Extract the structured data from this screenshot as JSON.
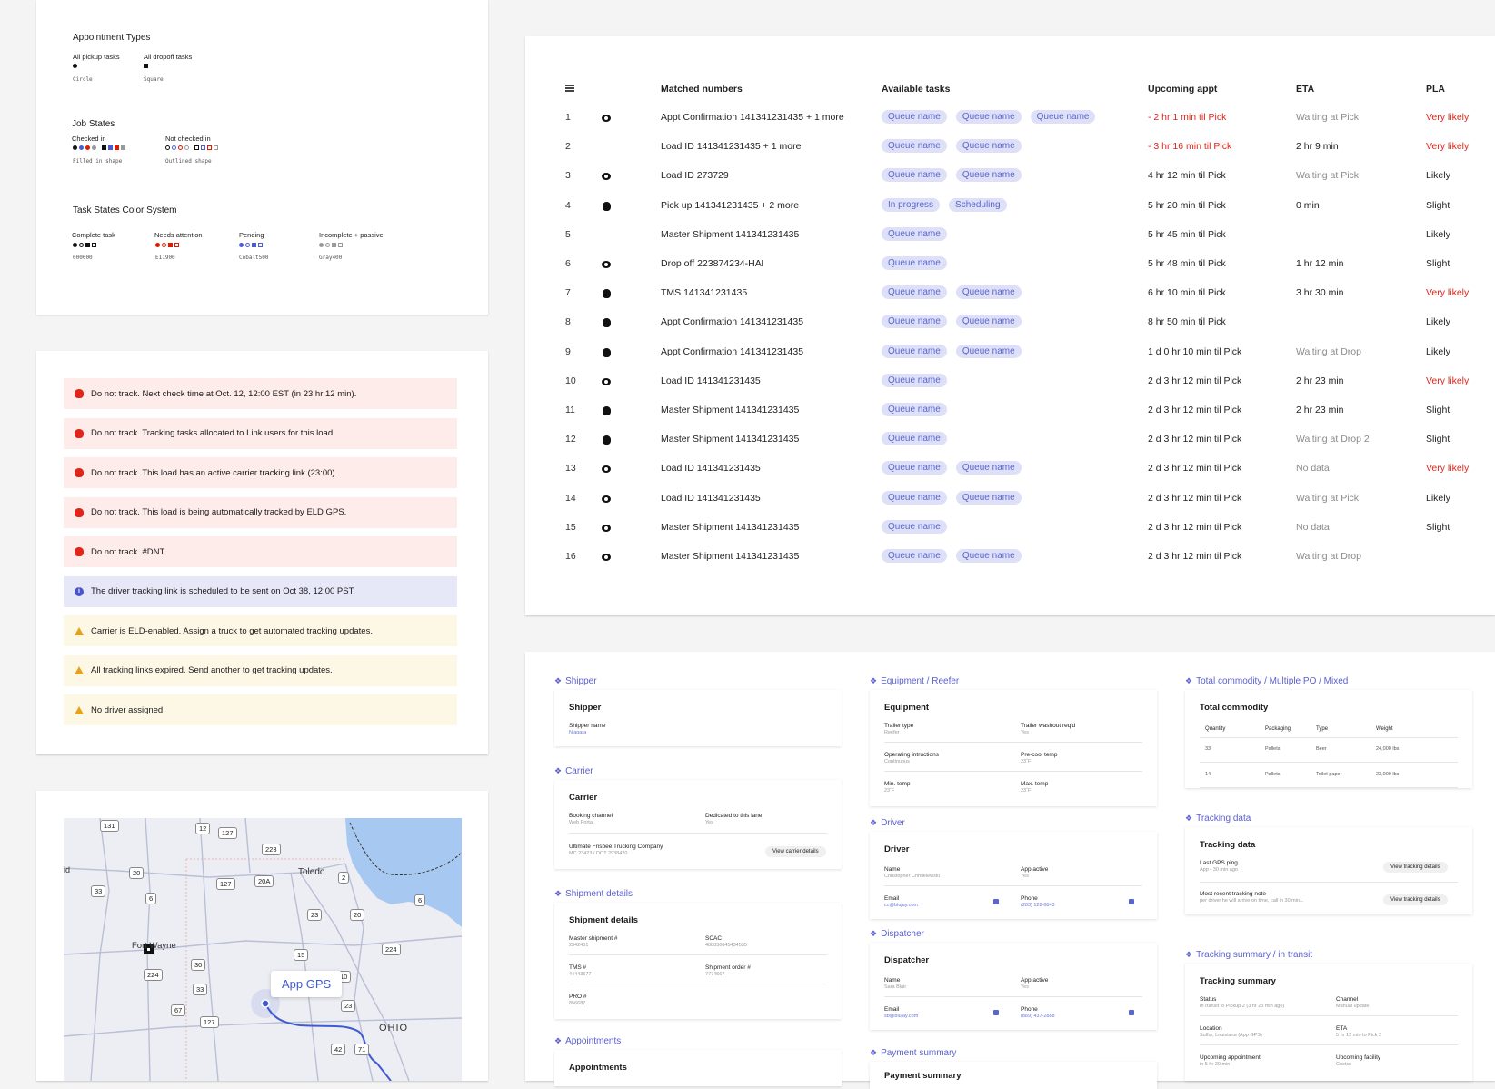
{
  "legend": {
    "appt_types": {
      "title": "Appointment Types",
      "pickup_label": "All pickup tasks",
      "pickup_shape": "Circle",
      "dropoff_label": "All dropoff tasks",
      "dropoff_shape": "Square"
    },
    "job_states": {
      "title": "Job States",
      "checked_in": "Checked in",
      "checked_in_caption": "Filled in shape",
      "not_checked_in": "Not checked in",
      "not_checked_in_caption": "Outlined shape"
    },
    "task_states": {
      "title": "Task States Color System",
      "complete": "Complete task",
      "complete_code": "000000",
      "attention": "Needs attention",
      "attention_code": "E11900",
      "pending": "Pending",
      "pending_code": "Cobalt500",
      "incomplete": "Incomplete + passive",
      "incomplete_code": "Gray400"
    },
    "colors": {
      "black": "#111111",
      "red": "#e11900",
      "blue": "#4a5cd8",
      "gray": "#9a9a9a"
    }
  },
  "banners": [
    {
      "type": "red",
      "icon": "hand-stop-icon",
      "text": "Do not track. Next check time at Oct. 12, 12:00 EST (in 23 hr 12 min)."
    },
    {
      "type": "red",
      "icon": "hand-stop-icon",
      "text": "Do not track. Tracking tasks allocated to Link users for this load."
    },
    {
      "type": "red",
      "icon": "hand-stop-icon",
      "text": "Do not track. This load has an active carrier tracking link (23:00)."
    },
    {
      "type": "red",
      "icon": "hand-stop-icon",
      "text": "Do not track. This load is being automatically tracked by ELD GPS."
    },
    {
      "type": "red",
      "icon": "hand-stop-icon",
      "text": "Do not track. #DNT"
    },
    {
      "type": "blue",
      "icon": "info-icon",
      "text": "The driver tracking link is scheduled to be sent on Oct 38, 12:00 PST."
    },
    {
      "type": "yel",
      "icon": "warning-icon",
      "text": "Carrier is ELD-enabled. Assign a truck to get automated tracking updates."
    },
    {
      "type": "yel",
      "icon": "warning-icon",
      "text": "All tracking links expired. Send another to get tracking updates."
    },
    {
      "type": "yel",
      "icon": "warning-icon",
      "text": "No driver assigned."
    }
  ],
  "map": {
    "tooltip": "App GPS",
    "places": [
      "Toledo",
      "Fort Wayne",
      "OHIO",
      "id"
    ],
    "shields": [
      "131",
      "12",
      "127",
      "223",
      "20",
      "127",
      "20A",
      "2",
      "33",
      "6",
      "6",
      "23",
      "20",
      "Fort Wayne",
      "224",
      "15",
      "224",
      "30",
      "10",
      "33",
      "67",
      "127",
      "23",
      "42",
      "71"
    ]
  },
  "table": {
    "headers": {
      "matched": "Matched numbers",
      "tasks": "Available tasks",
      "appt": "Upcoming appt",
      "eta": "ETA",
      "pla": "PLA"
    },
    "rows": [
      {
        "n": "1",
        "icon": "eye",
        "matched": "Appt Confirmation 141341231435 + 1 more",
        "chips": [
          "Queue name",
          "Queue name",
          "Queue name"
        ],
        "appt": "- 2 hr 1 min til Pick",
        "appt_red": true,
        "eta": "Waiting at Pick",
        "eta_gray": true,
        "pla": "Very likely",
        "pla_red": true
      },
      {
        "n": "2",
        "icon": "",
        "matched": "Load ID 141341231435 + 1 more",
        "chips": [
          "Queue name",
          "Queue name"
        ],
        "appt": "- 3 hr 16 min til Pick",
        "appt_red": true,
        "eta": "2 hr 9 min",
        "eta_gray": false,
        "pla": "Very likely",
        "pla_red": true
      },
      {
        "n": "3",
        "icon": "eye",
        "matched": "Load ID 273729",
        "chips": [
          "Queue name",
          "Queue name"
        ],
        "appt": "4 hr 12 min til Pick",
        "appt_red": false,
        "eta": "Waiting at Pick",
        "eta_gray": true,
        "pla": "Likely",
        "pla_red": false
      },
      {
        "n": "4",
        "icon": "hand",
        "matched": "Pick up 141341231435 + 2 more",
        "chips": [
          "In progress",
          "Scheduling"
        ],
        "appt": "5 hr 20 min til Pick",
        "appt_red": false,
        "eta": "0 min",
        "eta_gray": false,
        "pla": "Slight",
        "pla_red": false
      },
      {
        "n": "5",
        "icon": "",
        "matched": "Master Shipment 141341231435",
        "chips": [
          "Queue name"
        ],
        "appt": "5 hr 45 min til Pick",
        "appt_red": false,
        "eta": "",
        "eta_gray": false,
        "pla": "Likely",
        "pla_red": false
      },
      {
        "n": "6",
        "icon": "eye",
        "matched": "Drop off 223874234-HAI",
        "chips": [
          "Queue name"
        ],
        "appt": "5 hr 48 min til Pick",
        "appt_red": false,
        "eta": "1 hr 12 min",
        "eta_gray": false,
        "pla": "Slight",
        "pla_red": false
      },
      {
        "n": "7",
        "icon": "hand",
        "matched": "TMS 141341231435",
        "chips": [
          "Queue name",
          "Queue name"
        ],
        "appt": "6 hr 10 min til Pick",
        "appt_red": false,
        "eta": "3 hr 30 min",
        "eta_gray": false,
        "pla": "Very likely",
        "pla_red": true
      },
      {
        "n": "8",
        "icon": "hand",
        "matched": "Appt Confirmation 141341231435",
        "chips": [
          "Queue name",
          "Queue name"
        ],
        "appt": "8 hr 50 min til Pick",
        "appt_red": false,
        "eta": "",
        "eta_gray": false,
        "pla": "Likely",
        "pla_red": false
      },
      {
        "n": "9",
        "icon": "hand",
        "matched": "Appt Confirmation 141341231435",
        "chips": [
          "Queue name",
          "Queue name"
        ],
        "appt": "1 d 0 hr 10 min til Pick",
        "appt_red": false,
        "eta": "Waiting at Drop",
        "eta_gray": true,
        "pla": "Likely",
        "pla_red": false
      },
      {
        "n": "10",
        "icon": "eye",
        "matched": "Load ID 141341231435",
        "chips": [
          "Queue name"
        ],
        "appt": "2 d 3 hr 12 min til Pick",
        "appt_red": false,
        "eta": "2 hr 23 min",
        "eta_gray": false,
        "pla": "Very likely",
        "pla_red": true
      },
      {
        "n": "11",
        "icon": "hand",
        "matched": "Master Shipment 141341231435",
        "chips": [
          "Queue name"
        ],
        "appt": "2 d 3 hr 12 min til Pick",
        "appt_red": false,
        "eta": "2 hr 23 min",
        "eta_gray": false,
        "pla": "Slight",
        "pla_red": false
      },
      {
        "n": "12",
        "icon": "hand",
        "matched": "Master Shipment 141341231435",
        "chips": [
          "Queue name"
        ],
        "appt": "2 d 3 hr 12 min til Pick",
        "appt_red": false,
        "eta": "Waiting at Drop 2",
        "eta_gray": true,
        "pla": "Slight",
        "pla_red": false
      },
      {
        "n": "13",
        "icon": "eye",
        "matched": "Load ID 141341231435",
        "chips": [
          "Queue name",
          "Queue name"
        ],
        "appt": "2 d 3 hr 12 min til Pick",
        "appt_red": false,
        "eta": "No data",
        "eta_gray": true,
        "pla": "Very likely",
        "pla_red": true
      },
      {
        "n": "14",
        "icon": "eye",
        "matched": "Load ID 141341231435",
        "chips": [
          "Queue name",
          "Queue name"
        ],
        "appt": "2 d 3 hr 12 min til Pick",
        "appt_red": false,
        "eta": "Waiting at Pick",
        "eta_gray": true,
        "pla": "Likely",
        "pla_red": false
      },
      {
        "n": "15",
        "icon": "eye",
        "matched": "Master Shipment 141341231435",
        "chips": [
          "Queue name"
        ],
        "appt": "2 d 3 hr 12 min til Pick",
        "appt_red": false,
        "eta": "No data",
        "eta_gray": true,
        "pla": "Slight",
        "pla_red": false
      },
      {
        "n": "16",
        "icon": "eye",
        "matched": "Master Shipment 141341231435",
        "chips": [
          "Queue name",
          "Queue name"
        ],
        "appt": "2 d 3 hr 12 min til Pick",
        "appt_red": false,
        "eta": "Waiting at Drop",
        "eta_gray": true,
        "pla": "",
        "pla_red": false
      }
    ]
  },
  "details": {
    "shipper": {
      "section": "Shipper",
      "title": "Shipper",
      "name_label": "Shipper name",
      "name_value": "Niagara"
    },
    "carrier": {
      "section": "Carrier",
      "title": "Carrier",
      "booking_label": "Booking channel",
      "booking_value": "Web Portal",
      "dedicated_label": "Dedicated to this lane",
      "dedicated_value": "Yes",
      "company": "Ultimate Frisbee Trucking Company",
      "mc": "MC 23423 / DOT 2938420",
      "button": "View carrier details"
    },
    "shipment": {
      "section": "Shipment details",
      "title": "Shipment details",
      "master_label": "Master shipment #",
      "master_value": "2342451",
      "scac_label": "SCAC",
      "scac_value": "488856645434535",
      "tms_label": "TMS #",
      "tms_value": "44443677",
      "order_label": "Shipment order #",
      "order_value": "7774567",
      "pro_label": "PRO #",
      "pro_value": "856687"
    },
    "appointments": {
      "section": "Appointments",
      "title": "Appointments"
    },
    "equipment": {
      "section": "Equipment / Reefer",
      "title": "Equipment",
      "trailer_label": "Trailer type",
      "trailer_value": "Reefer",
      "washout_label": "Trailer washout req'd",
      "washout_value": "Yes",
      "ops_label": "Operating intructions",
      "ops_value": "Continuous",
      "precool_label": "Pre-cool temp",
      "precool_value": "23˚F",
      "min_label": "Min. temp",
      "min_value": "23˚F",
      "max_label": "Max. temp",
      "max_value": "23˚F"
    },
    "driver": {
      "section": "Driver",
      "title": "Driver",
      "name_label": "Name",
      "name_value": "Christopher Chmielewski",
      "app_label": "App active",
      "app_value": "Yes",
      "email_label": "Email",
      "email_value": "cc@blujay.com",
      "phone_label": "Phone",
      "phone_value": "(283) 128-6843"
    },
    "dispatcher": {
      "section": "Dispatcher",
      "title": "Dispatcher",
      "name_label": "Name",
      "name_value": "Sara Blair",
      "app_label": "App active",
      "app_value": "Yes",
      "email_label": "Email",
      "email_value": "sb@blujay.com",
      "phone_label": "Phone",
      "phone_value": "(889) 437-2888"
    },
    "payment": {
      "section": "Payment summary",
      "title": "Payment summary"
    },
    "commodity": {
      "section": "Total commodity / Multiple PO / Mixed",
      "title": "Total commodity",
      "headers": [
        "Quantity",
        "Packaging",
        "Type",
        "Weight"
      ],
      "rows": [
        [
          "33",
          "Pallets",
          "Beer",
          "24,000 lbs"
        ],
        [
          "14",
          "Pallets",
          "Toilet paper",
          "23,000 lbs"
        ]
      ]
    },
    "tracking": {
      "section": "Tracking data",
      "title": "Tracking data",
      "ping_label": "Last GPS ping",
      "ping_value": "App • 30 min ago",
      "note_label": "Most recent tracking note",
      "note_value": "per driver he will arrive on time, call in 30 min...",
      "button": "View tracking details"
    },
    "summary": {
      "section": "Tracking summary / in transit",
      "title": "Tracking summary",
      "status_label": "Status",
      "status_value": "In transit to Pickup 2 (3 hr 23 min ago)",
      "channel_label": "Channel",
      "channel_value": "Manual update",
      "location_label": "Location",
      "location_value": "Sulfur, Louisiana (App GPS)",
      "eta_label": "ETA",
      "eta_value": "5 hr 12 min to Pick 2",
      "upappt_label": "Upcoming appointment",
      "upappt_value": "in 5 hr 30 min",
      "upfac_label": "Upcoming facility",
      "upfac_value": "Costco"
    }
  }
}
